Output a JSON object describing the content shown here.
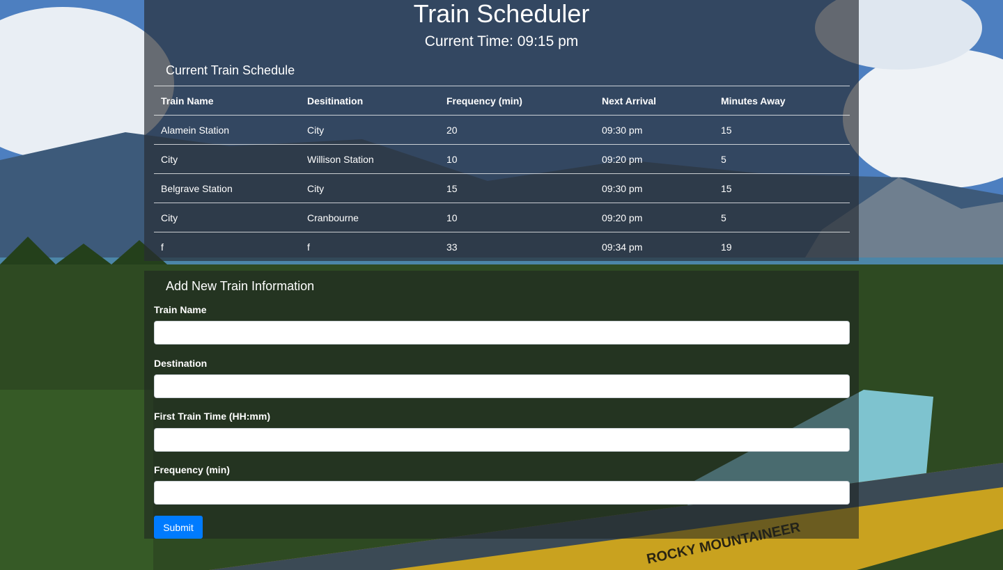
{
  "app": {
    "title": "Train Scheduler",
    "current_time_label": "Current Time: 09:15 pm"
  },
  "schedule": {
    "heading": "Current Train Schedule",
    "columns": [
      "Train Name",
      "Desitination",
      "Frequency (min)",
      "Next Arrival",
      "Minutes Away"
    ],
    "rows": [
      [
        "Alamein Station",
        "City",
        "20",
        "09:30 pm",
        "15"
      ],
      [
        "City",
        "Willison Station",
        "10",
        "09:20 pm",
        "5"
      ],
      [
        "Belgrave Station",
        "City",
        "15",
        "09:30 pm",
        "15"
      ],
      [
        "City",
        "Cranbourne",
        "10",
        "09:20 pm",
        "5"
      ],
      [
        "f",
        "f",
        "33",
        "09:34 pm",
        "19"
      ]
    ]
  },
  "form": {
    "heading": "Add New Train Information",
    "train_name_label": "Train Name",
    "destination_label": "Destination",
    "first_time_label": "First Train Time (HH:mm)",
    "frequency_label": "Frequency (min)",
    "train_name_value": "",
    "destination_value": "",
    "first_time_value": "",
    "frequency_value": "",
    "submit_label": "Submit"
  },
  "background": {
    "description_icon": "mountain-train-landscape-image",
    "train_sign_text": "ROCKY MOUNTAINEER"
  },
  "colors": {
    "accent": "#007bff",
    "panel": "#282c34",
    "text": "#ffffff"
  }
}
